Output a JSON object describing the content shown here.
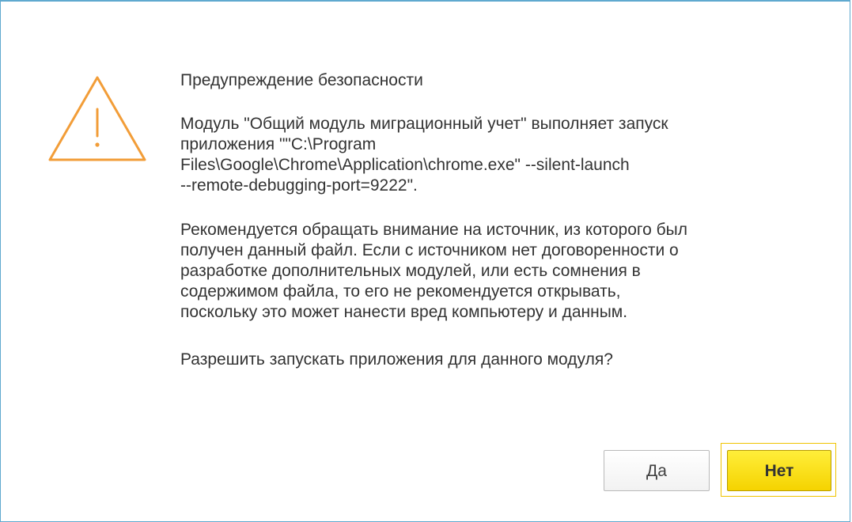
{
  "dialog": {
    "title": "Предупреждение безопасности",
    "module_message": "Модуль \"Общий модуль миграционный учет\" выполняет запуск\nприложения \"\"C:\\Program\nFiles\\Google\\Chrome\\Application\\chrome.exe\" --silent-launch\n--remote-debugging-port=9222\".",
    "advice": "Рекомендуется обращать внимание на источник, из которого был\nполучен данный файл. Если с источником нет договоренности о\nразработке дополнительных модулей, или есть сомнения в\nсодержимом файла, то его не рекомендуется открывать,\nпоскольку это может нанести вред компьютеру и данным.",
    "question": "Разрешить запускать приложения для данного модуля?",
    "icon": "warning-triangle-icon",
    "icon_color": "#f29d38",
    "accent_color": "#5fa9cf"
  },
  "buttons": {
    "yes_label": "Да",
    "no_label": "Нет",
    "default_color": "#f5d300"
  }
}
